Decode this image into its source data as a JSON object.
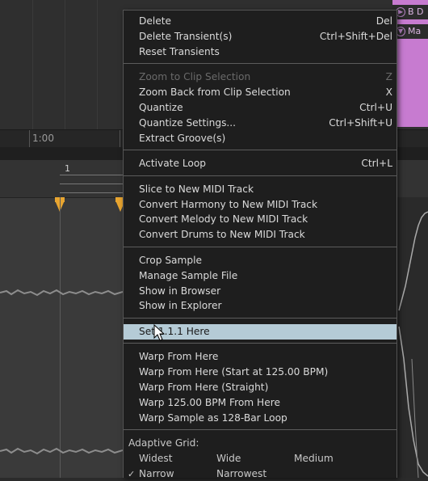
{
  "background": {
    "time_label": "1:00",
    "bar_number": "1",
    "tracks": [
      {
        "icon": "play-circle-icon",
        "glyph": "▶",
        "label": "B D"
      },
      {
        "icon": "fold-circle-icon",
        "glyph": "▼",
        "label": "Ma"
      }
    ]
  },
  "menu": {
    "groups": [
      [
        {
          "label": "Delete",
          "shortcut": "Del",
          "enabled": true
        },
        {
          "label": "Delete Transient(s)",
          "shortcut": "Ctrl+Shift+Del",
          "enabled": true
        },
        {
          "label": "Reset Transients",
          "shortcut": "",
          "enabled": true
        }
      ],
      [
        {
          "label": "Zoom to Clip Selection",
          "shortcut": "Z",
          "enabled": false
        },
        {
          "label": "Zoom Back from Clip Selection",
          "shortcut": "X",
          "enabled": true
        },
        {
          "label": "Quantize",
          "shortcut": "Ctrl+U",
          "enabled": true
        },
        {
          "label": "Quantize Settings...",
          "shortcut": "Ctrl+Shift+U",
          "enabled": true
        },
        {
          "label": "Extract Groove(s)",
          "shortcut": "",
          "enabled": true
        }
      ],
      [
        {
          "label": "Activate Loop",
          "shortcut": "Ctrl+L",
          "enabled": true
        }
      ],
      [
        {
          "label": "Slice to New MIDI Track",
          "shortcut": "",
          "enabled": true
        },
        {
          "label": "Convert Harmony to New MIDI Track",
          "shortcut": "",
          "enabled": true
        },
        {
          "label": "Convert Melody to New MIDI Track",
          "shortcut": "",
          "enabled": true
        },
        {
          "label": "Convert Drums to New MIDI Track",
          "shortcut": "",
          "enabled": true
        }
      ],
      [
        {
          "label": "Crop Sample",
          "shortcut": "",
          "enabled": true
        },
        {
          "label": "Manage Sample File",
          "shortcut": "",
          "enabled": true
        },
        {
          "label": "Show in Browser",
          "shortcut": "",
          "enabled": true
        },
        {
          "label": "Show in Explorer",
          "shortcut": "",
          "enabled": true
        }
      ],
      [
        {
          "label": "Set 1.1.1 Here",
          "shortcut": "",
          "enabled": true,
          "highlighted": true
        }
      ],
      [
        {
          "label": "Warp From Here",
          "shortcut": "",
          "enabled": true
        },
        {
          "label": "Warp From Here (Start at 125.00 BPM)",
          "shortcut": "",
          "enabled": true
        },
        {
          "label": "Warp From Here (Straight)",
          "shortcut": "",
          "enabled": true
        },
        {
          "label": "Warp 125.00 BPM From Here",
          "shortcut": "",
          "enabled": true
        },
        {
          "label": "Warp Sample as 128-Bar Loop",
          "shortcut": "",
          "enabled": true
        }
      ]
    ],
    "adaptive_grid": {
      "header": "Adaptive Grid:",
      "row1": [
        "Widest",
        "Wide",
        "Medium"
      ],
      "row2": [
        "Narrow",
        "Narrowest"
      ],
      "checked": "Narrow"
    }
  },
  "colors": {
    "menu_bg": "#1e1e1e",
    "highlight": "#b5cbd6",
    "track_purple": "#c77bd0",
    "warp_marker": "#e8a530"
  }
}
